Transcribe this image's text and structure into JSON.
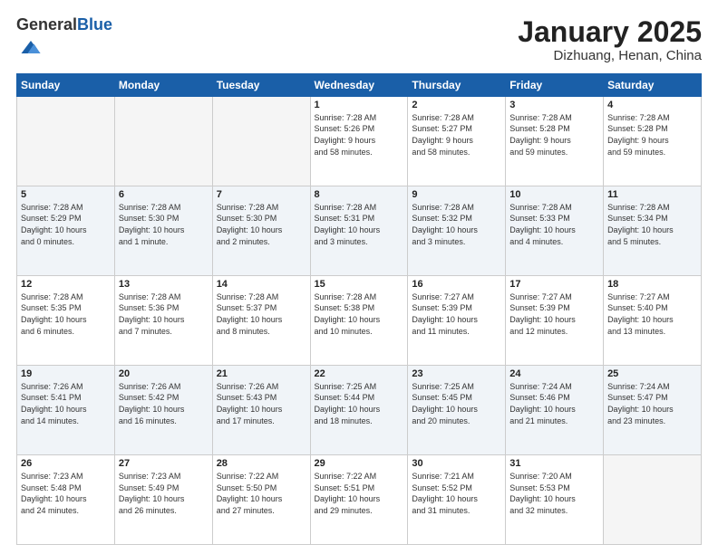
{
  "header": {
    "logo_general": "General",
    "logo_blue": "Blue",
    "title": "January 2025",
    "subtitle": "Dizhuang, Henan, China"
  },
  "days_of_week": [
    "Sunday",
    "Monday",
    "Tuesday",
    "Wednesday",
    "Thursday",
    "Friday",
    "Saturday"
  ],
  "weeks": [
    {
      "shade": false,
      "days": [
        {
          "num": "",
          "info": "",
          "empty": true
        },
        {
          "num": "",
          "info": "",
          "empty": true
        },
        {
          "num": "",
          "info": "",
          "empty": true
        },
        {
          "num": "1",
          "info": "Sunrise: 7:28 AM\nSunset: 5:26 PM\nDaylight: 9 hours\nand 58 minutes.",
          "empty": false
        },
        {
          "num": "2",
          "info": "Sunrise: 7:28 AM\nSunset: 5:27 PM\nDaylight: 9 hours\nand 58 minutes.",
          "empty": false
        },
        {
          "num": "3",
          "info": "Sunrise: 7:28 AM\nSunset: 5:28 PM\nDaylight: 9 hours\nand 59 minutes.",
          "empty": false
        },
        {
          "num": "4",
          "info": "Sunrise: 7:28 AM\nSunset: 5:28 PM\nDaylight: 9 hours\nand 59 minutes.",
          "empty": false
        }
      ]
    },
    {
      "shade": true,
      "days": [
        {
          "num": "5",
          "info": "Sunrise: 7:28 AM\nSunset: 5:29 PM\nDaylight: 10 hours\nand 0 minutes.",
          "empty": false
        },
        {
          "num": "6",
          "info": "Sunrise: 7:28 AM\nSunset: 5:30 PM\nDaylight: 10 hours\nand 1 minute.",
          "empty": false
        },
        {
          "num": "7",
          "info": "Sunrise: 7:28 AM\nSunset: 5:30 PM\nDaylight: 10 hours\nand 2 minutes.",
          "empty": false
        },
        {
          "num": "8",
          "info": "Sunrise: 7:28 AM\nSunset: 5:31 PM\nDaylight: 10 hours\nand 3 minutes.",
          "empty": false
        },
        {
          "num": "9",
          "info": "Sunrise: 7:28 AM\nSunset: 5:32 PM\nDaylight: 10 hours\nand 3 minutes.",
          "empty": false
        },
        {
          "num": "10",
          "info": "Sunrise: 7:28 AM\nSunset: 5:33 PM\nDaylight: 10 hours\nand 4 minutes.",
          "empty": false
        },
        {
          "num": "11",
          "info": "Sunrise: 7:28 AM\nSunset: 5:34 PM\nDaylight: 10 hours\nand 5 minutes.",
          "empty": false
        }
      ]
    },
    {
      "shade": false,
      "days": [
        {
          "num": "12",
          "info": "Sunrise: 7:28 AM\nSunset: 5:35 PM\nDaylight: 10 hours\nand 6 minutes.",
          "empty": false
        },
        {
          "num": "13",
          "info": "Sunrise: 7:28 AM\nSunset: 5:36 PM\nDaylight: 10 hours\nand 7 minutes.",
          "empty": false
        },
        {
          "num": "14",
          "info": "Sunrise: 7:28 AM\nSunset: 5:37 PM\nDaylight: 10 hours\nand 8 minutes.",
          "empty": false
        },
        {
          "num": "15",
          "info": "Sunrise: 7:28 AM\nSunset: 5:38 PM\nDaylight: 10 hours\nand 10 minutes.",
          "empty": false
        },
        {
          "num": "16",
          "info": "Sunrise: 7:27 AM\nSunset: 5:39 PM\nDaylight: 10 hours\nand 11 minutes.",
          "empty": false
        },
        {
          "num": "17",
          "info": "Sunrise: 7:27 AM\nSunset: 5:39 PM\nDaylight: 10 hours\nand 12 minutes.",
          "empty": false
        },
        {
          "num": "18",
          "info": "Sunrise: 7:27 AM\nSunset: 5:40 PM\nDaylight: 10 hours\nand 13 minutes.",
          "empty": false
        }
      ]
    },
    {
      "shade": true,
      "days": [
        {
          "num": "19",
          "info": "Sunrise: 7:26 AM\nSunset: 5:41 PM\nDaylight: 10 hours\nand 14 minutes.",
          "empty": false
        },
        {
          "num": "20",
          "info": "Sunrise: 7:26 AM\nSunset: 5:42 PM\nDaylight: 10 hours\nand 16 minutes.",
          "empty": false
        },
        {
          "num": "21",
          "info": "Sunrise: 7:26 AM\nSunset: 5:43 PM\nDaylight: 10 hours\nand 17 minutes.",
          "empty": false
        },
        {
          "num": "22",
          "info": "Sunrise: 7:25 AM\nSunset: 5:44 PM\nDaylight: 10 hours\nand 18 minutes.",
          "empty": false
        },
        {
          "num": "23",
          "info": "Sunrise: 7:25 AM\nSunset: 5:45 PM\nDaylight: 10 hours\nand 20 minutes.",
          "empty": false
        },
        {
          "num": "24",
          "info": "Sunrise: 7:24 AM\nSunset: 5:46 PM\nDaylight: 10 hours\nand 21 minutes.",
          "empty": false
        },
        {
          "num": "25",
          "info": "Sunrise: 7:24 AM\nSunset: 5:47 PM\nDaylight: 10 hours\nand 23 minutes.",
          "empty": false
        }
      ]
    },
    {
      "shade": false,
      "days": [
        {
          "num": "26",
          "info": "Sunrise: 7:23 AM\nSunset: 5:48 PM\nDaylight: 10 hours\nand 24 minutes.",
          "empty": false
        },
        {
          "num": "27",
          "info": "Sunrise: 7:23 AM\nSunset: 5:49 PM\nDaylight: 10 hours\nand 26 minutes.",
          "empty": false
        },
        {
          "num": "28",
          "info": "Sunrise: 7:22 AM\nSunset: 5:50 PM\nDaylight: 10 hours\nand 27 minutes.",
          "empty": false
        },
        {
          "num": "29",
          "info": "Sunrise: 7:22 AM\nSunset: 5:51 PM\nDaylight: 10 hours\nand 29 minutes.",
          "empty": false
        },
        {
          "num": "30",
          "info": "Sunrise: 7:21 AM\nSunset: 5:52 PM\nDaylight: 10 hours\nand 31 minutes.",
          "empty": false
        },
        {
          "num": "31",
          "info": "Sunrise: 7:20 AM\nSunset: 5:53 PM\nDaylight: 10 hours\nand 32 minutes.",
          "empty": false
        },
        {
          "num": "",
          "info": "",
          "empty": true
        }
      ]
    }
  ]
}
